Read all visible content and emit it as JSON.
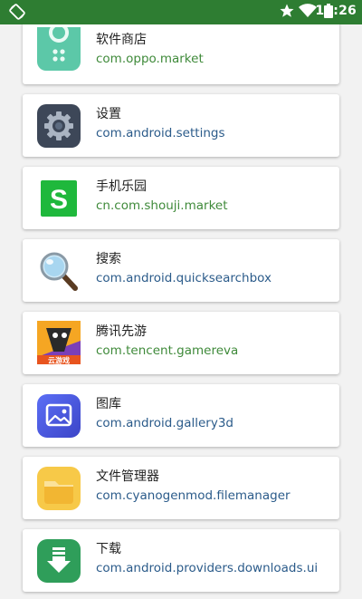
{
  "status_bar": {
    "time": "10:26",
    "icons": [
      "screen-rotate-icon",
      "star-icon",
      "wifi-icon",
      "battery-icon"
    ]
  },
  "apps": [
    {
      "name": "软件商店",
      "package": "com.oppo.market",
      "icon": "store-icon"
    },
    {
      "name": "设置",
      "package": "com.android.settings",
      "icon": "settings-gear-icon"
    },
    {
      "name": "手机乐园",
      "package": "cn.com.shouji.market",
      "icon": "shouji-market-icon"
    },
    {
      "name": "搜索",
      "package": "com.android.quicksearchbox",
      "icon": "magnifier-icon"
    },
    {
      "name": "腾讯先游",
      "package": "com.tencent.gamereva",
      "icon": "tencent-game-icon"
    },
    {
      "name": "图库",
      "package": "com.android.gallery3d",
      "icon": "gallery-icon"
    },
    {
      "name": "文件管理器",
      "package": "com.cyanogenmod.filemanager",
      "icon": "folder-icon"
    },
    {
      "name": "下载",
      "package": "com.android.providers.downloads.ui",
      "icon": "download-icon"
    }
  ],
  "icon_texts": {
    "tencent_badge": "云游戏",
    "shouji_letter": "S"
  },
  "colors": {
    "status_bar": "#2e7d32",
    "package_text": "#2b5b8a",
    "package_text_green": "#3f8a3a"
  }
}
